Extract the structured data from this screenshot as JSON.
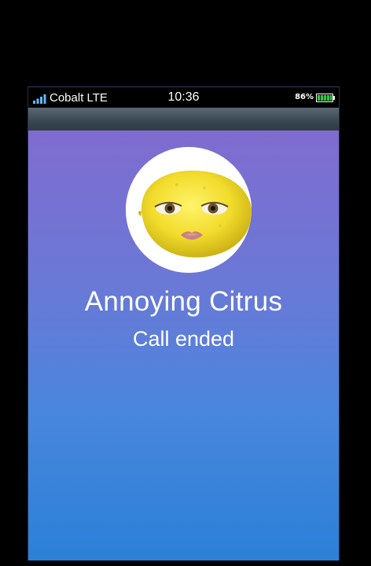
{
  "status_bar": {
    "carrier": "Cobalt LTE",
    "time": "10:36",
    "battery_percent": "86%",
    "battery_level": 0.86,
    "signal_bars": 4,
    "signal_icon": "signal-bars-icon",
    "battery_icon": "battery-icon"
  },
  "call": {
    "contact_name": "Annoying Citrus",
    "status": "Call ended",
    "avatar": "lemon-face-avatar"
  },
  "colors": {
    "gradient_top": "#806cd0",
    "gradient_bottom": "#2b80d8",
    "battery_fill": "#2ecc40",
    "signal_color": "#5fb8ff"
  }
}
